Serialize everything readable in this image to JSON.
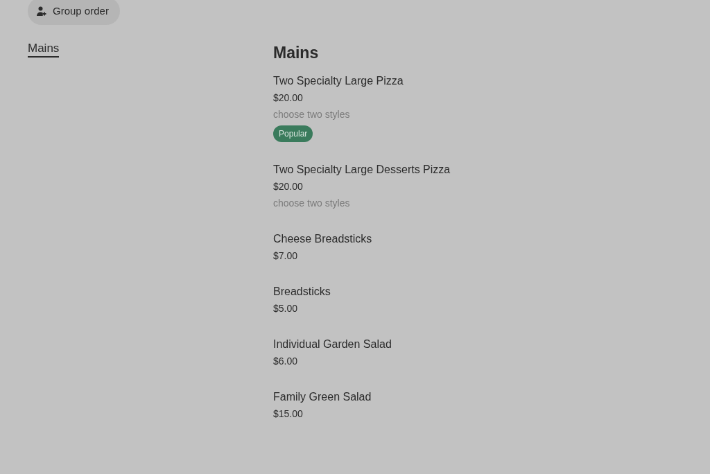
{
  "top_bar": {
    "group_order_button": "Group order"
  },
  "sidebar": {
    "categories": [
      {
        "label": "Mains",
        "selected": true
      }
    ]
  },
  "menu_section": {
    "title": "Mains",
    "items": [
      {
        "name": "Two Specialty Large Pizza",
        "price": "$20.00",
        "description": "choose two styles",
        "badge": "Popular"
      },
      {
        "name": "Two Specialty Large Desserts Pizza",
        "price": "$20.00",
        "description": "choose two styles"
      },
      {
        "name": "Cheese Breadsticks",
        "price": "$7.00"
      },
      {
        "name": "Breadsticks",
        "price": "$5.00"
      },
      {
        "name": "Individual Garden Salad",
        "price": "$6.00"
      },
      {
        "name": "Family Green Salad",
        "price": "$15.00"
      }
    ]
  }
}
